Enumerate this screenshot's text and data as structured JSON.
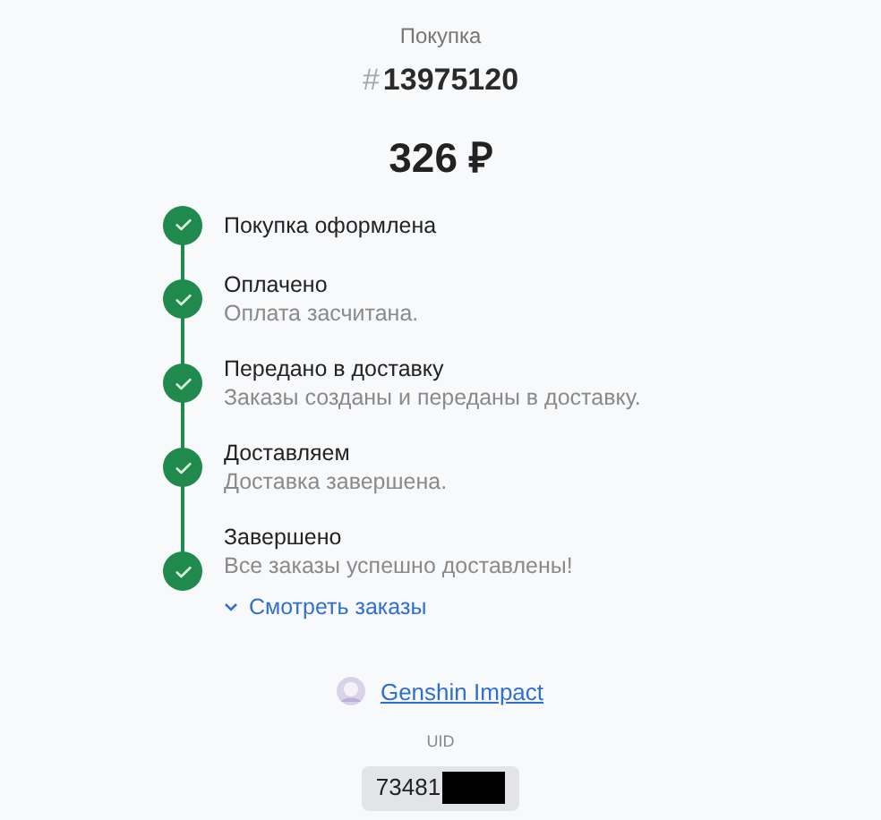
{
  "header": {
    "label": "Покупка",
    "hash": "#",
    "order_number": "13975120",
    "price": "326 ₽"
  },
  "steps": [
    {
      "title": "Покупка оформлена",
      "done": true
    },
    {
      "title": "Оплачено",
      "description": "Оплата засчитана.",
      "done": true
    },
    {
      "title": "Передано в доставку",
      "description": "Заказы созданы и переданы в доставку.",
      "done": true
    },
    {
      "title": "Доставляем",
      "description": "Доставка завершена.",
      "done": true
    },
    {
      "title": "Завершено",
      "description": "Все заказы успешно доставлены!",
      "done": true,
      "link": "Смотреть заказы"
    }
  ],
  "game": {
    "name": "Genshin Impact",
    "uid_label": "UID",
    "uid_value": "73481",
    "uid_redacted": true
  }
}
